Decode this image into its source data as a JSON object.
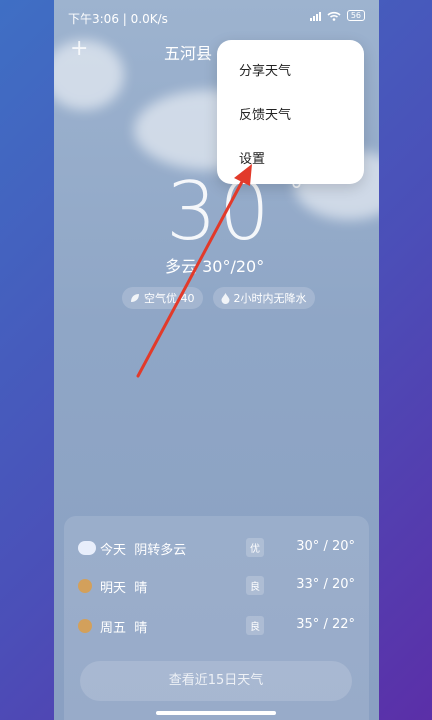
{
  "status": {
    "time": "下午3:06 | 0.0K/s",
    "battery": "56"
  },
  "header": {
    "add": "+",
    "city": "五河县"
  },
  "menu": {
    "items": [
      "分享天气",
      "反馈天气",
      "设置"
    ]
  },
  "current": {
    "temp": "30",
    "deg": "°",
    "cond": "多云 30°/20°",
    "air": "空气优 40",
    "rain": "2小时内无降水"
  },
  "forecast": [
    {
      "day": "今天",
      "weather": "阴转多云",
      "aq": "优",
      "temp": "30° / 20°",
      "icon": "cloud-icon",
      "color": "#e8eefb"
    },
    {
      "day": "明天",
      "weather": "晴",
      "aq": "良",
      "temp": "33° / 20°",
      "icon": "sun-icon",
      "color": "#d3a05b"
    },
    {
      "day": "周五",
      "weather": "晴",
      "aq": "良",
      "temp": "35° / 22°",
      "icon": "sun-icon",
      "color": "#d3a05b"
    }
  ],
  "more": "查看近15日天气"
}
